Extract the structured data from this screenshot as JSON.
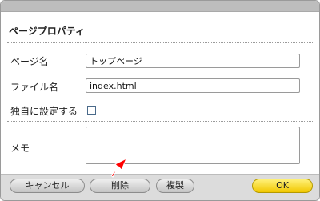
{
  "panel": {
    "title": "ページプロパティ"
  },
  "fields": {
    "page_name": {
      "label": "ページ名",
      "value": "トップページ"
    },
    "file_name": {
      "label": "ファイル名",
      "value": "index.html"
    },
    "custom_setting": {
      "label": "独自に設定する",
      "checked": false
    },
    "memo": {
      "label": "メモ",
      "value": ""
    }
  },
  "buttons": {
    "cancel": "キャンセル",
    "delete": "削除",
    "duplicate": "複製",
    "ok": "OK"
  },
  "colors": {
    "ok_button": "#f1c700",
    "arrow": "#ff0000"
  },
  "icons": {
    "pointer": "red-arrow-icon"
  }
}
